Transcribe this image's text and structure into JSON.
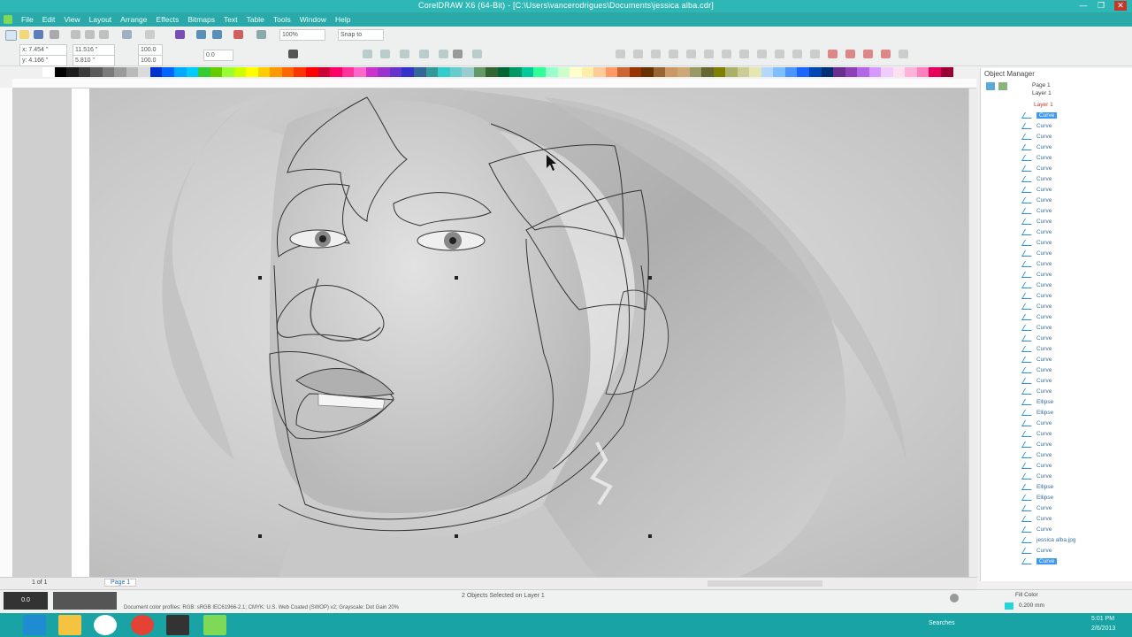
{
  "window": {
    "title": "CorelDRAW X6 (64-Bit) - [C:\\Users\\vancerodrigues\\Documents\\jessica alba.cdr]",
    "controls": [
      "minimize-icon",
      "restore-icon",
      "close-icon"
    ]
  },
  "menu": [
    "File",
    "Edit",
    "View",
    "Layout",
    "Arrange",
    "Effects",
    "Bitmaps",
    "Text",
    "Table",
    "Tools",
    "Window",
    "Help"
  ],
  "toolbar": {
    "zoom": "100%",
    "snap_to": "Snap to"
  },
  "property_bar": {
    "x": "x: 7.454 \"",
    "y": "y: 4.166 \"",
    "width": "11.516 \"",
    "height": "5.810 \"",
    "scale_w": "100.0",
    "scale_h": "100.0",
    "rotation": "0.0"
  },
  "palette_colors": [
    "#ffffff",
    "#000000",
    "#1c1c1c",
    "#3a3a3a",
    "#5a5a5a",
    "#7a7a7a",
    "#9a9a9a",
    "#bababa",
    "#dadada",
    "#0033cc",
    "#0066ff",
    "#00aaff",
    "#00ccff",
    "#33cc33",
    "#66cc00",
    "#99ff33",
    "#ccff00",
    "#ffff00",
    "#ffcc00",
    "#ff9900",
    "#ff6600",
    "#ff3300",
    "#ff0000",
    "#cc0033",
    "#ff0066",
    "#ff3399",
    "#ff66cc",
    "#cc33cc",
    "#9933cc",
    "#6633cc",
    "#3333cc",
    "#336699",
    "#339999",
    "#33cccc",
    "#66cccc",
    "#99cccc",
    "#669966",
    "#336633",
    "#006633",
    "#009966",
    "#00cc99",
    "#33ff99",
    "#99ffcc",
    "#ccffcc",
    "#ffffcc",
    "#ffeeaa",
    "#ffcc99",
    "#ff9966",
    "#cc6633",
    "#993300",
    "#663300",
    "#996633",
    "#cc9966",
    "#ccaa77",
    "#999966",
    "#666633",
    "#808000",
    "#aab066",
    "#cccc99",
    "#e6e6b3",
    "#b3d9ff",
    "#80bfff",
    "#4d94ff",
    "#1a66ff",
    "#0047b3",
    "#002e73",
    "#6b2e8f",
    "#8f3fb8",
    "#b366e6",
    "#d699ff",
    "#f0ccff",
    "#ffe0f0",
    "#ffb3d9",
    "#ff80bf",
    "#e6005c",
    "#990033"
  ],
  "canvas": {
    "artwork_description": "grayscale portrait"
  },
  "object_manager": {
    "title": "Object Manager",
    "page": "Page 1",
    "layer": "Layer 1",
    "sublayer": "Layer 1",
    "items": [
      "Curve",
      "Curve",
      "Curve",
      "Curve",
      "Curve",
      "Curve",
      "Curve",
      "Curve",
      "Curve",
      "Curve",
      "Curve",
      "Curve",
      "Curve",
      "Curve",
      "Curve",
      "Curve",
      "Curve",
      "Curve",
      "Curve",
      "Curve",
      "Curve",
      "Curve",
      "Curve",
      "Curve",
      "Curve",
      "Curve",
      "Curve",
      "Ellipse",
      "Ellipse",
      "Curve",
      "Curve",
      "Curve",
      "Curve",
      "Curve",
      "Curve",
      "Ellipse",
      "Ellipse",
      "Curve",
      "Curve",
      "Curve",
      "jessica alba.jpg",
      "Curve",
      "Curve"
    ],
    "fill_label": "Fill Color",
    "outline_label": "0.200 mm"
  },
  "page_tabs": {
    "counter": "1 of 1",
    "tab": "Page 1"
  },
  "status": {
    "selection": "2 Objects Selected on Layer 1",
    "color_profile": "Document color profiles: RGB: sRGB IEC61966-2.1; CMYK: U.S. Web Coated (SWOP) v2; Grayscale: Dot Gain 20%"
  },
  "taskbar": {
    "search": "Searches",
    "time": "5:01 PM",
    "date": "2/6/2013"
  }
}
